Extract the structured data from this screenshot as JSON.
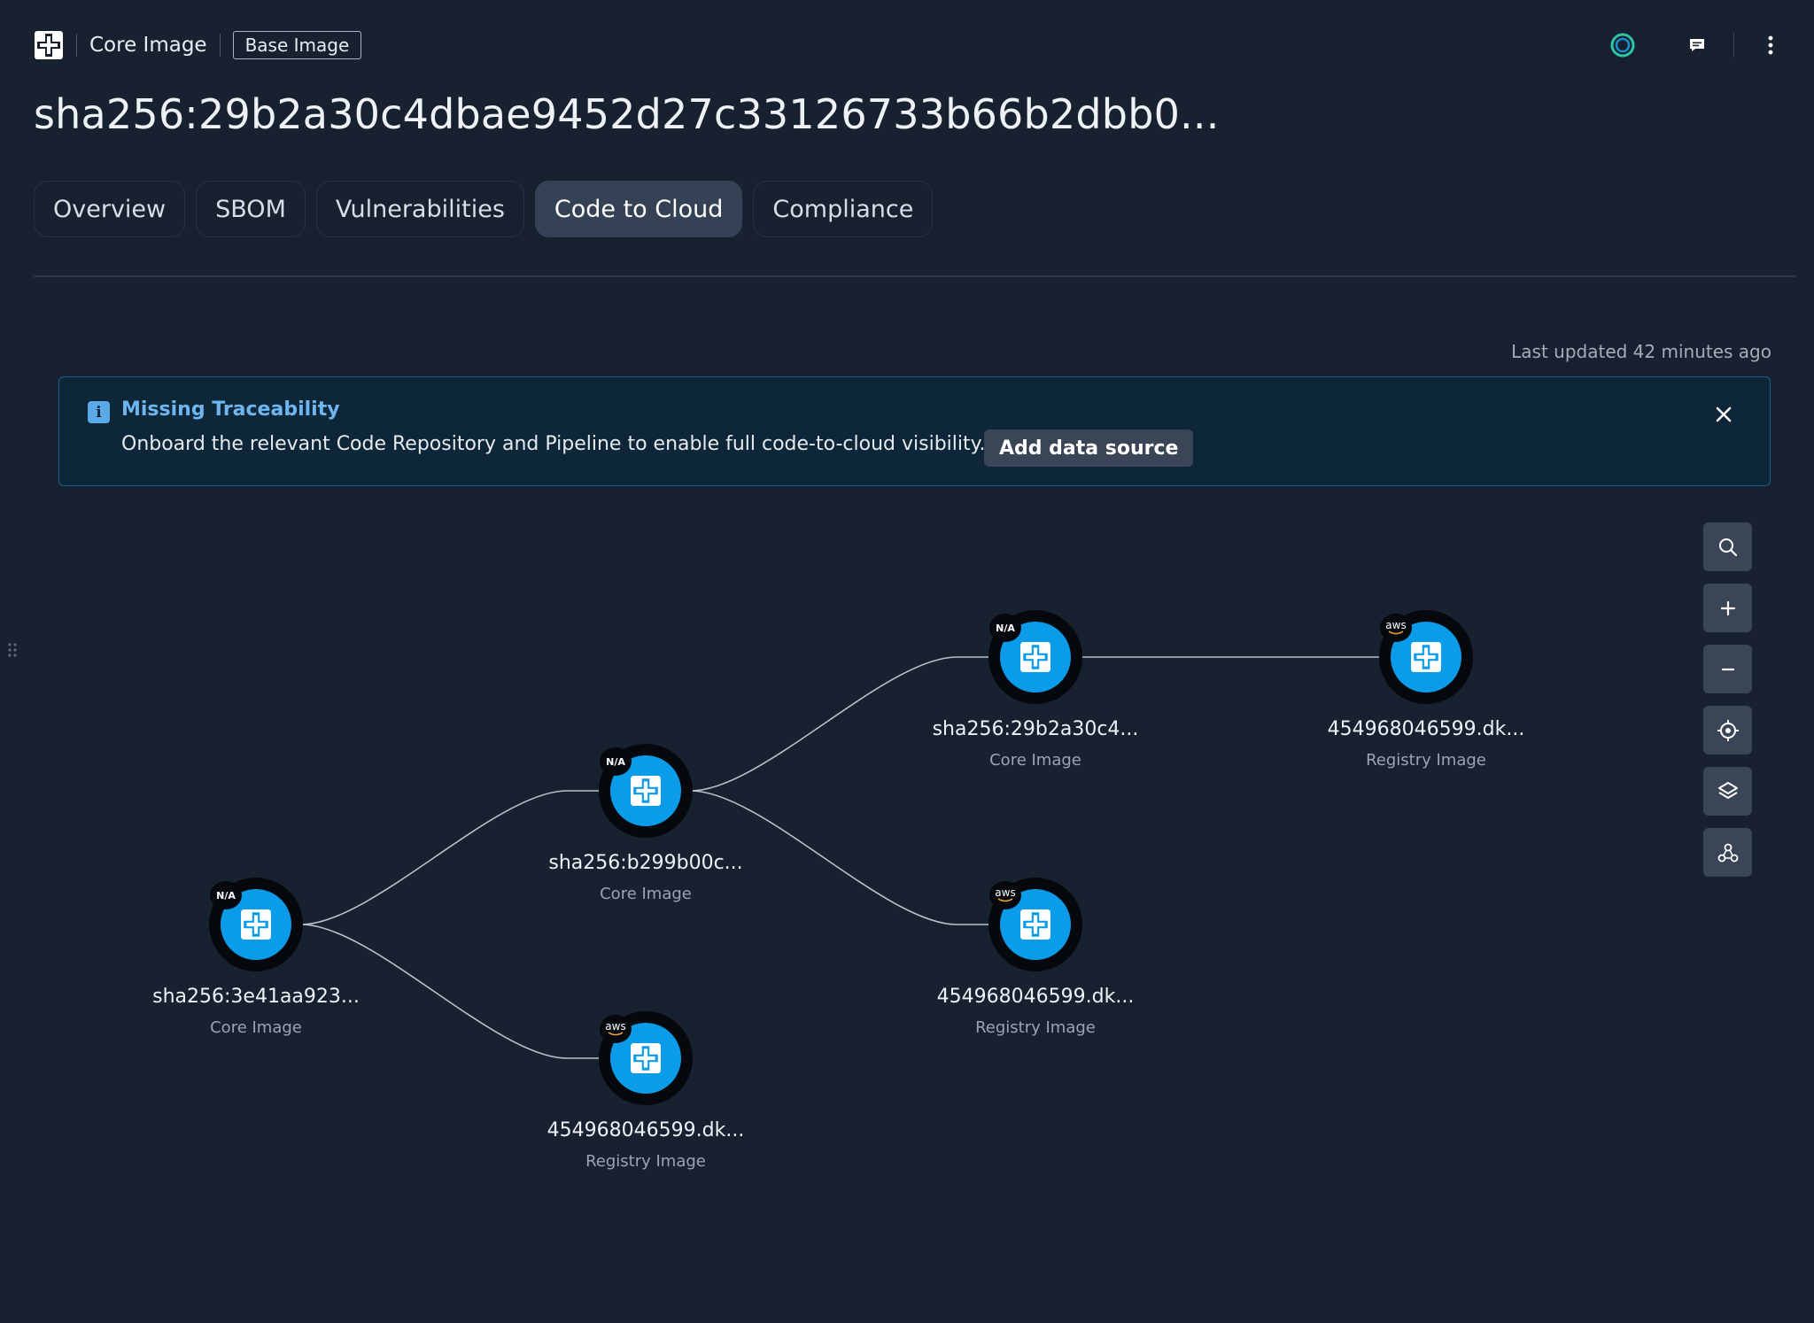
{
  "header": {
    "breadcrumb": "Core Image",
    "badge": "Base Image",
    "title": "sha256:29b2a30c4dbae9452d27c33126733b66b2dbb0..."
  },
  "tabs": [
    {
      "label": "Overview",
      "active": false
    },
    {
      "label": "SBOM",
      "active": false
    },
    {
      "label": "Vulnerabilities",
      "active": false
    },
    {
      "label": "Code to Cloud",
      "active": true
    },
    {
      "label": "Compliance",
      "active": false
    }
  ],
  "status": {
    "last_updated": "Last updated 42 minutes ago"
  },
  "banner": {
    "title": "Missing Traceability",
    "text": "Onboard the relevant Code Repository and Pipeline to enable full code-to-cloud visibility.",
    "button": "Add data source"
  },
  "graph": {
    "nodes": [
      {
        "id": "n1",
        "label": "sha256:3e41aa923...",
        "type": "Core Image",
        "tag": "N/A"
      },
      {
        "id": "n2",
        "label": "sha256:b299b00c...",
        "type": "Core Image",
        "tag": "N/A"
      },
      {
        "id": "n3",
        "label": "454968046599.dk...",
        "type": "Registry Image",
        "tag": "aws"
      },
      {
        "id": "n4",
        "label": "sha256:29b2a30c4...",
        "type": "Core Image",
        "tag": "N/A"
      },
      {
        "id": "n5",
        "label": "454968046599.dk...",
        "type": "Registry Image",
        "tag": "aws"
      },
      {
        "id": "n6",
        "label": "454968046599.dk...",
        "type": "Registry Image",
        "tag": "aws"
      }
    ]
  },
  "icons": {
    "logo": "prisma-logo-icon",
    "status": "status-ring-icon",
    "chat": "chat-icon",
    "more": "more-vertical-icon"
  },
  "colors": {
    "background": "#182130",
    "accent": "#0a9ce8",
    "banner_bg": "#0d2638",
    "banner_border": "#1c5e86",
    "tab_active": "#354256"
  }
}
